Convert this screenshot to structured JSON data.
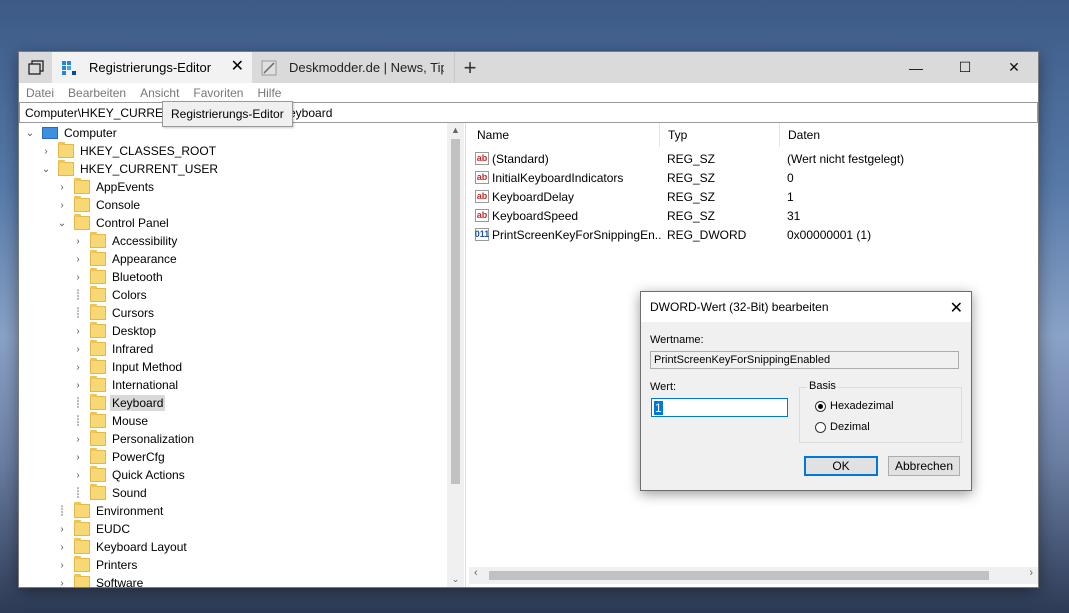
{
  "tabs": [
    {
      "label": "Registrierungs-Editor",
      "active": true
    },
    {
      "label": "Deskmodder.de | News, Tip",
      "active": false
    }
  ],
  "window_controls": {
    "minimize": "—",
    "maximize": "☐",
    "close": "✕"
  },
  "menu": [
    "Datei",
    "Bearbeiten",
    "Ansicht",
    "Favoriten",
    "Hilfe"
  ],
  "address": {
    "left": "Computer\\HKEY_CURREN",
    "right": "eyboard"
  },
  "tooltip": "Registrierungs-Editor",
  "tree": {
    "computer": "Computer",
    "hkcr": "HKEY_CLASSES_ROOT",
    "hkcu": "HKEY_CURRENT_USER",
    "hkcu_children": [
      "AppEvents",
      "Console",
      "Control Panel"
    ],
    "control_panel_children": [
      "Accessibility",
      "Appearance",
      "Bluetooth",
      "Colors",
      "Cursors",
      "Desktop",
      "Infrared",
      "Input Method",
      "International",
      "Keyboard",
      "Mouse",
      "Personalization",
      "PowerCfg",
      "Quick Actions",
      "Sound"
    ],
    "hkcu_more": [
      "Environment",
      "EUDC",
      "Keyboard Layout",
      "Printers",
      "Software"
    ]
  },
  "list": {
    "headers": {
      "name": "Name",
      "type": "Typ",
      "data": "Daten"
    },
    "rows": [
      {
        "name": "(Standard)",
        "type": "REG_SZ",
        "data": "(Wert nicht festgelegt)"
      },
      {
        "name": "InitialKeyboardIndicators",
        "type": "REG_SZ",
        "data": "0"
      },
      {
        "name": "KeyboardDelay",
        "type": "REG_SZ",
        "data": "1"
      },
      {
        "name": "KeyboardSpeed",
        "type": "REG_SZ",
        "data": "31"
      },
      {
        "name": "PrintScreenKeyForSnippingEn...",
        "type": "REG_DWORD",
        "data": "0x00000001 (1)"
      }
    ]
  },
  "dialog": {
    "title": "DWORD-Wert (32-Bit) bearbeiten",
    "name_label": "Wertname:",
    "name_value": "PrintScreenKeyForSnippingEnabled",
    "value_label": "Wert:",
    "value": "1",
    "base_label": "Basis",
    "hex_label": "Hexadezimal",
    "dec_label": "Dezimal",
    "ok": "OK",
    "cancel": "Abbrechen"
  },
  "icons": {
    "string_value": "ab",
    "binary_value": "011"
  }
}
